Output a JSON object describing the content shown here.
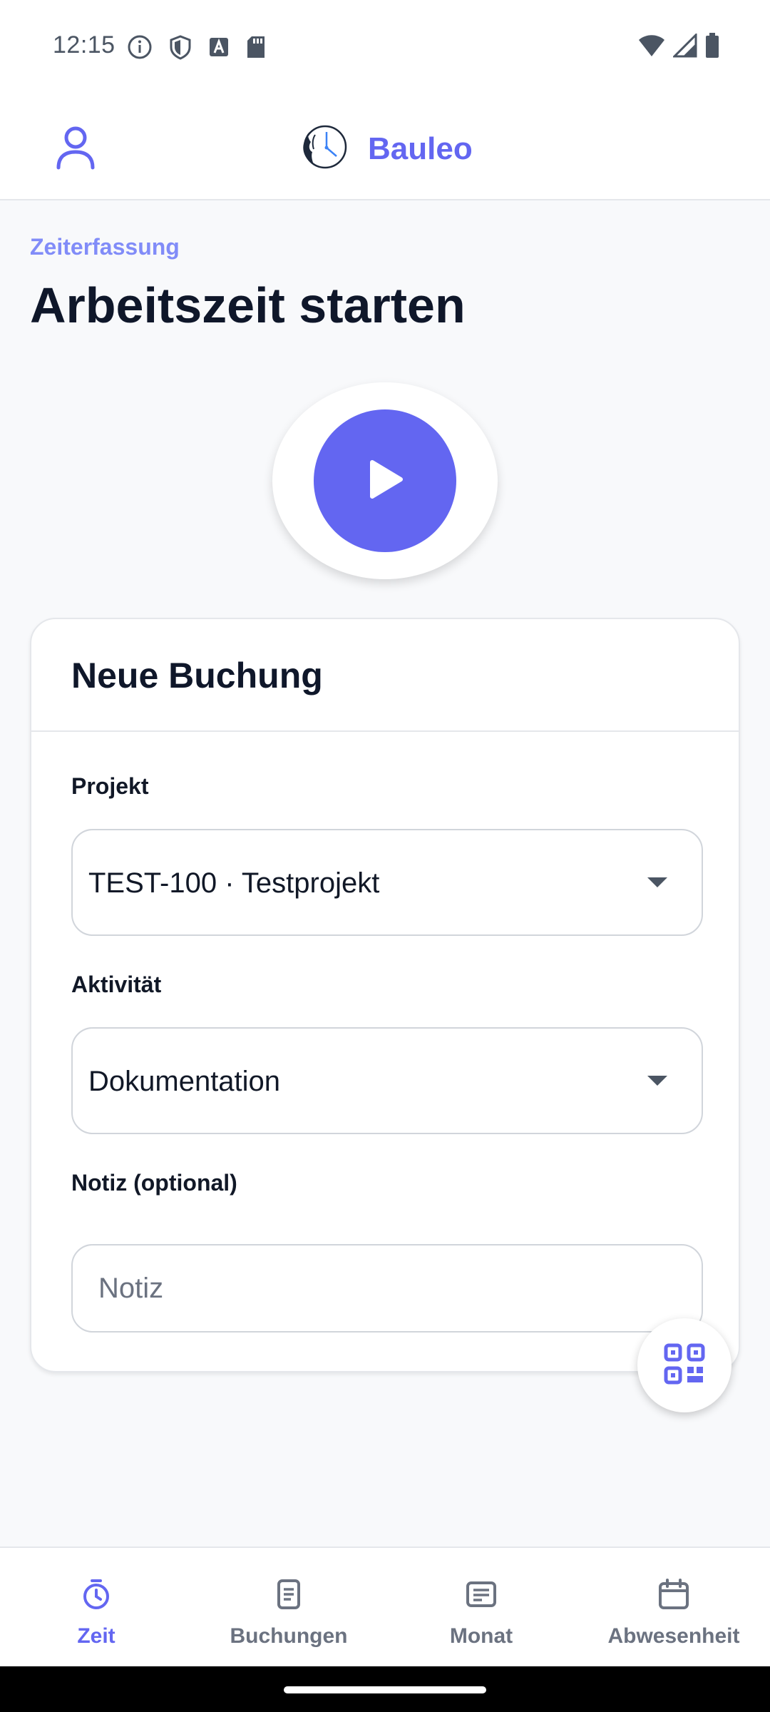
{
  "status_bar": {
    "time": "12:15",
    "left_icons": [
      "info-circle-icon",
      "shield-icon",
      "font-a-icon",
      "sd-card-icon"
    ],
    "right_icons": [
      "wifi-icon",
      "cellular-signal-icon",
      "battery-icon"
    ]
  },
  "header": {
    "brand_name": "Bauleo",
    "profile_icon": "person-icon",
    "logo_icon": "lion-clock-logo"
  },
  "page": {
    "eyebrow": "Zeiterfassung",
    "title": "Arbeitszeit starten"
  },
  "start_button": {
    "icon": "play-icon",
    "color": "#6366f1"
  },
  "booking_form": {
    "title": "Neue Buchung",
    "project_label": "Projekt",
    "project_value": "TEST-100 · Testprojekt",
    "activity_label": "Aktivität",
    "activity_value": "Dokumentation",
    "note_label": "Notiz (optional)",
    "note_placeholder": "Notiz",
    "note_value": ""
  },
  "qr_button": {
    "icon": "qr-code-icon"
  },
  "bottom_nav": {
    "items": [
      {
        "label": "Zeit",
        "icon": "stopwatch-icon",
        "active": true
      },
      {
        "label": "Buchungen",
        "icon": "document-icon",
        "active": false
      },
      {
        "label": "Monat",
        "icon": "list-card-icon",
        "active": false
      },
      {
        "label": "Abwesenheit",
        "icon": "calendar-icon",
        "active": false
      }
    ]
  },
  "colors": {
    "accent": "#6366f1",
    "accent_light": "#818cf8",
    "nav_inactive": "#6b7280",
    "background": "#f8f9fb"
  }
}
